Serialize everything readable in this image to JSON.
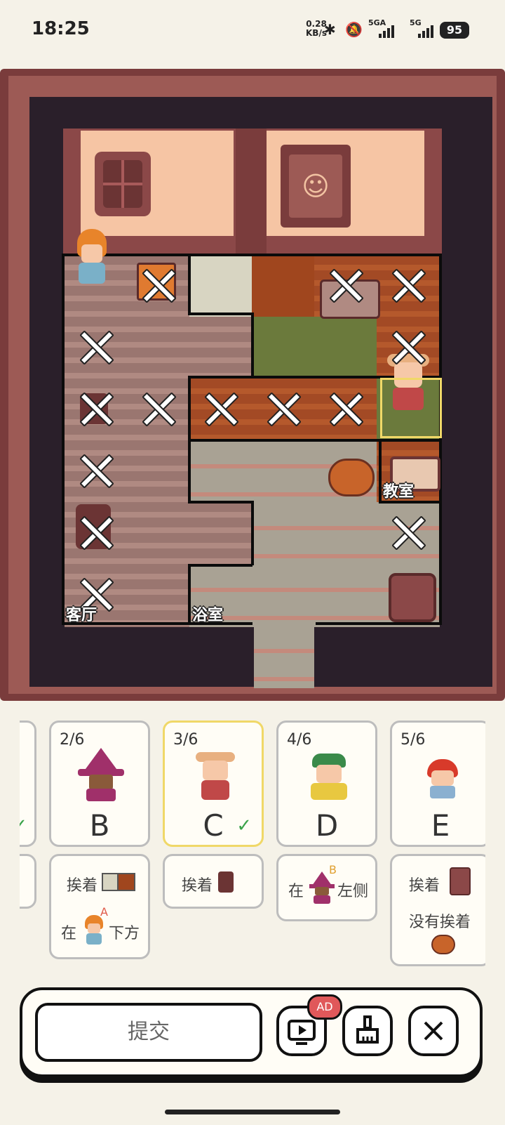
{
  "status_bar": {
    "time": "18:25",
    "net_speed_value": "0.28",
    "net_speed_unit": "KB/s",
    "sim1": "5GA",
    "sim2": "5G",
    "battery": "95"
  },
  "board": {
    "rooms": {
      "living_room": "客厅",
      "bathroom": "浴室",
      "classroom": "教室"
    }
  },
  "characters": [
    {
      "progress": "2/6",
      "letter": "B",
      "solved": false
    },
    {
      "progress": "3/6",
      "letter": "C",
      "solved": true,
      "checkmark": "✓"
    },
    {
      "progress": "4/6",
      "letter": "D",
      "solved": false
    },
    {
      "progress": "5/6",
      "letter": "E",
      "solved": false
    }
  ],
  "clues": {
    "b": {
      "line1": "挨着",
      "line2_pre": "在",
      "line2_ref": "A",
      "line2_post": "下方"
    },
    "c": {
      "line1": "挨着"
    },
    "d": {
      "pre": "在",
      "ref": "B",
      "post": "左侧"
    },
    "e": {
      "line1": "挨着",
      "line2": "没有挨着"
    }
  },
  "toolbar": {
    "submit_label": "提交",
    "ad_badge": "AD"
  },
  "colors": {
    "accent_selected": "#f0d868",
    "check_green": "#3aa34a",
    "ad_red": "#e0585a",
    "board_frame": "#7a3c3c"
  }
}
